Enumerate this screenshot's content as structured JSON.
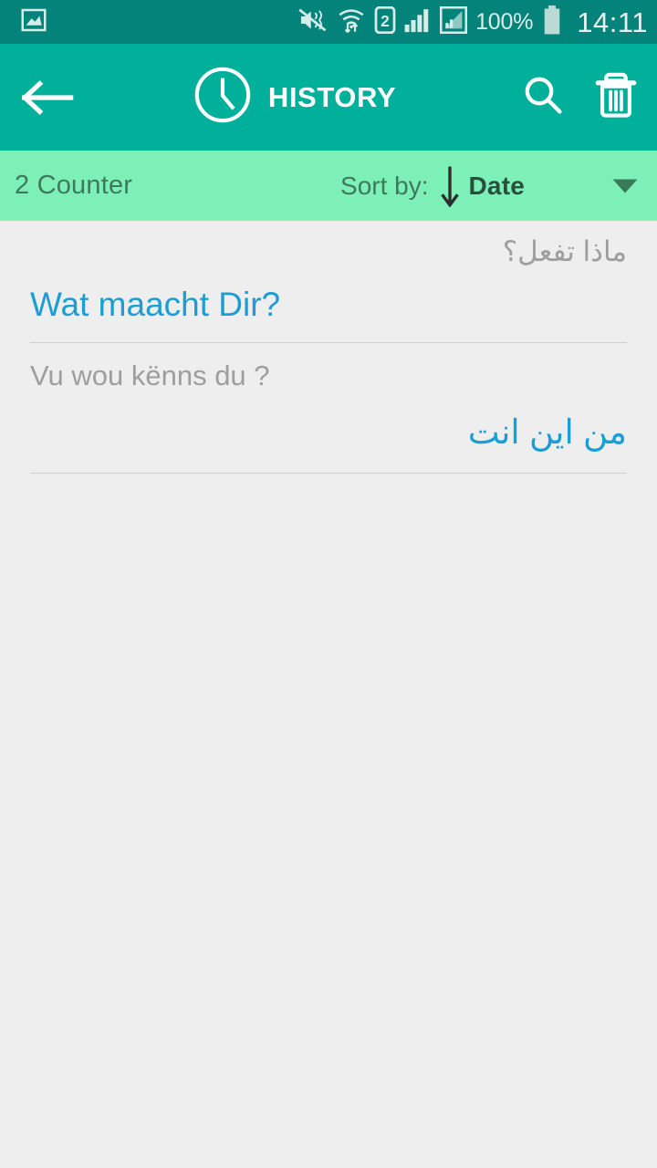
{
  "status_bar": {
    "icons": [
      "image-notification-icon",
      "mute-vibrate-icon",
      "wifi-transfer-icon",
      "sim2-icon",
      "signal-bars-icon",
      "signal-secondary-icon"
    ],
    "battery_percent": "100%",
    "time": "14:11",
    "background_color": "#04837a"
  },
  "app_bar": {
    "back_label": "Back",
    "title": "HISTORY",
    "title_icon": "clock-icon",
    "search_label": "Search",
    "delete_label": "Delete all",
    "background_color": "#00b09b"
  },
  "sort_bar": {
    "counter": "2 Counter",
    "sort_by_label": "Sort by:",
    "sort_direction": "descending",
    "sort_value": "Date",
    "background_color": "#7df0b8"
  },
  "history": {
    "items": [
      {
        "source_text": "ماذا تفعل؟",
        "source_dir": "rtl",
        "target_text": "Wat maacht Dir?",
        "target_dir": "ltr"
      },
      {
        "source_text": "Vu wou kënns du ?",
        "source_dir": "ltr",
        "target_text": "من اين انت",
        "target_dir": "rtl"
      }
    ]
  },
  "colors": {
    "accent_teal": "#00b09b",
    "status_teal": "#04837a",
    "mint": "#7df0b8",
    "translation_blue": "#1b9ed4",
    "source_gray": "#9e9e9e",
    "page_background": "#eeeeee"
  }
}
